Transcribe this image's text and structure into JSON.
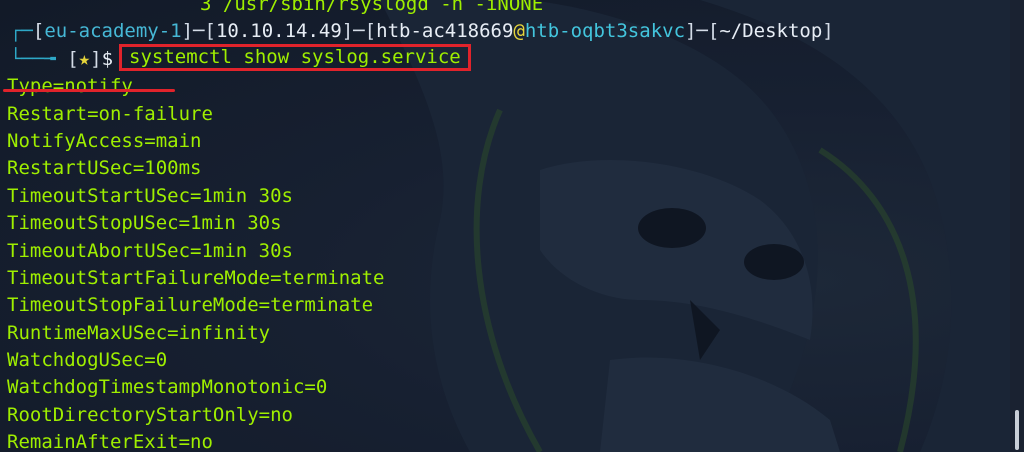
{
  "terminal": {
    "previous_line": "3 /usr/sbin/rsyslogd -n -iNONE",
    "prompt": {
      "region": "eu-academy-1",
      "ip": "10.10.14.49",
      "user": "htb-ac418669",
      "at": "@",
      "host": "htb-oqbt3sakvc",
      "path": "~/Desktop",
      "status_symbol": "★",
      "dollar": "$"
    },
    "command": "systemctl show syslog.service",
    "output": [
      "Type=notify",
      "Restart=on-failure",
      "NotifyAccess=main",
      "RestartUSec=100ms",
      "TimeoutStartUSec=1min 30s",
      "TimeoutStopUSec=1min 30s",
      "TimeoutAbortUSec=1min 30s",
      "TimeoutStartFailureMode=terminate",
      "TimeoutStopFailureMode=terminate",
      "RuntimeMaxUSec=infinity",
      "WatchdogUSec=0",
      "WatchdogTimestampMonotonic=0",
      "RootDirectoryStartOnly=no",
      "RemainAfterExit=no"
    ]
  },
  "colors": {
    "background": "#141c2b",
    "text": "#9fef00",
    "frame": "#2ea8c7",
    "highlight_box": "#e1232b",
    "star": "#e6d53a"
  },
  "icons": {
    "background_logo": "hackthebox-skull-logo"
  }
}
